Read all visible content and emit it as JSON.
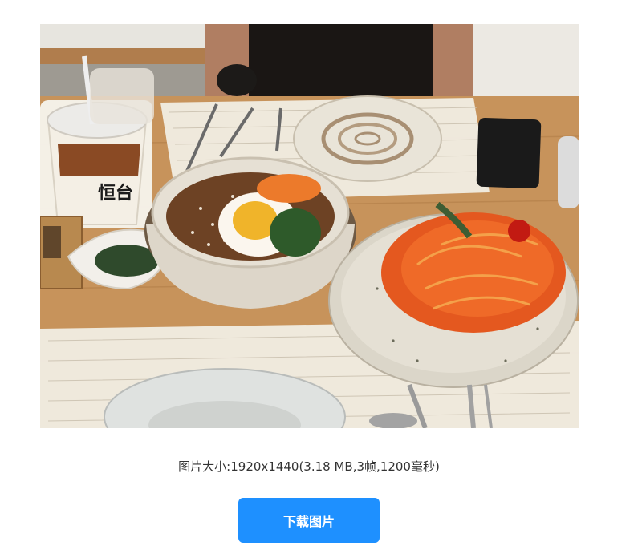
{
  "image": {
    "alt_icon": "food-photo",
    "cup_label": "恒台"
  },
  "info": {
    "text": "图片大小:1920x1440(3.18 MB,3帧,1200毫秒)"
  },
  "actions": {
    "download_label": "下载图片",
    "button_color": "#1e90ff"
  }
}
